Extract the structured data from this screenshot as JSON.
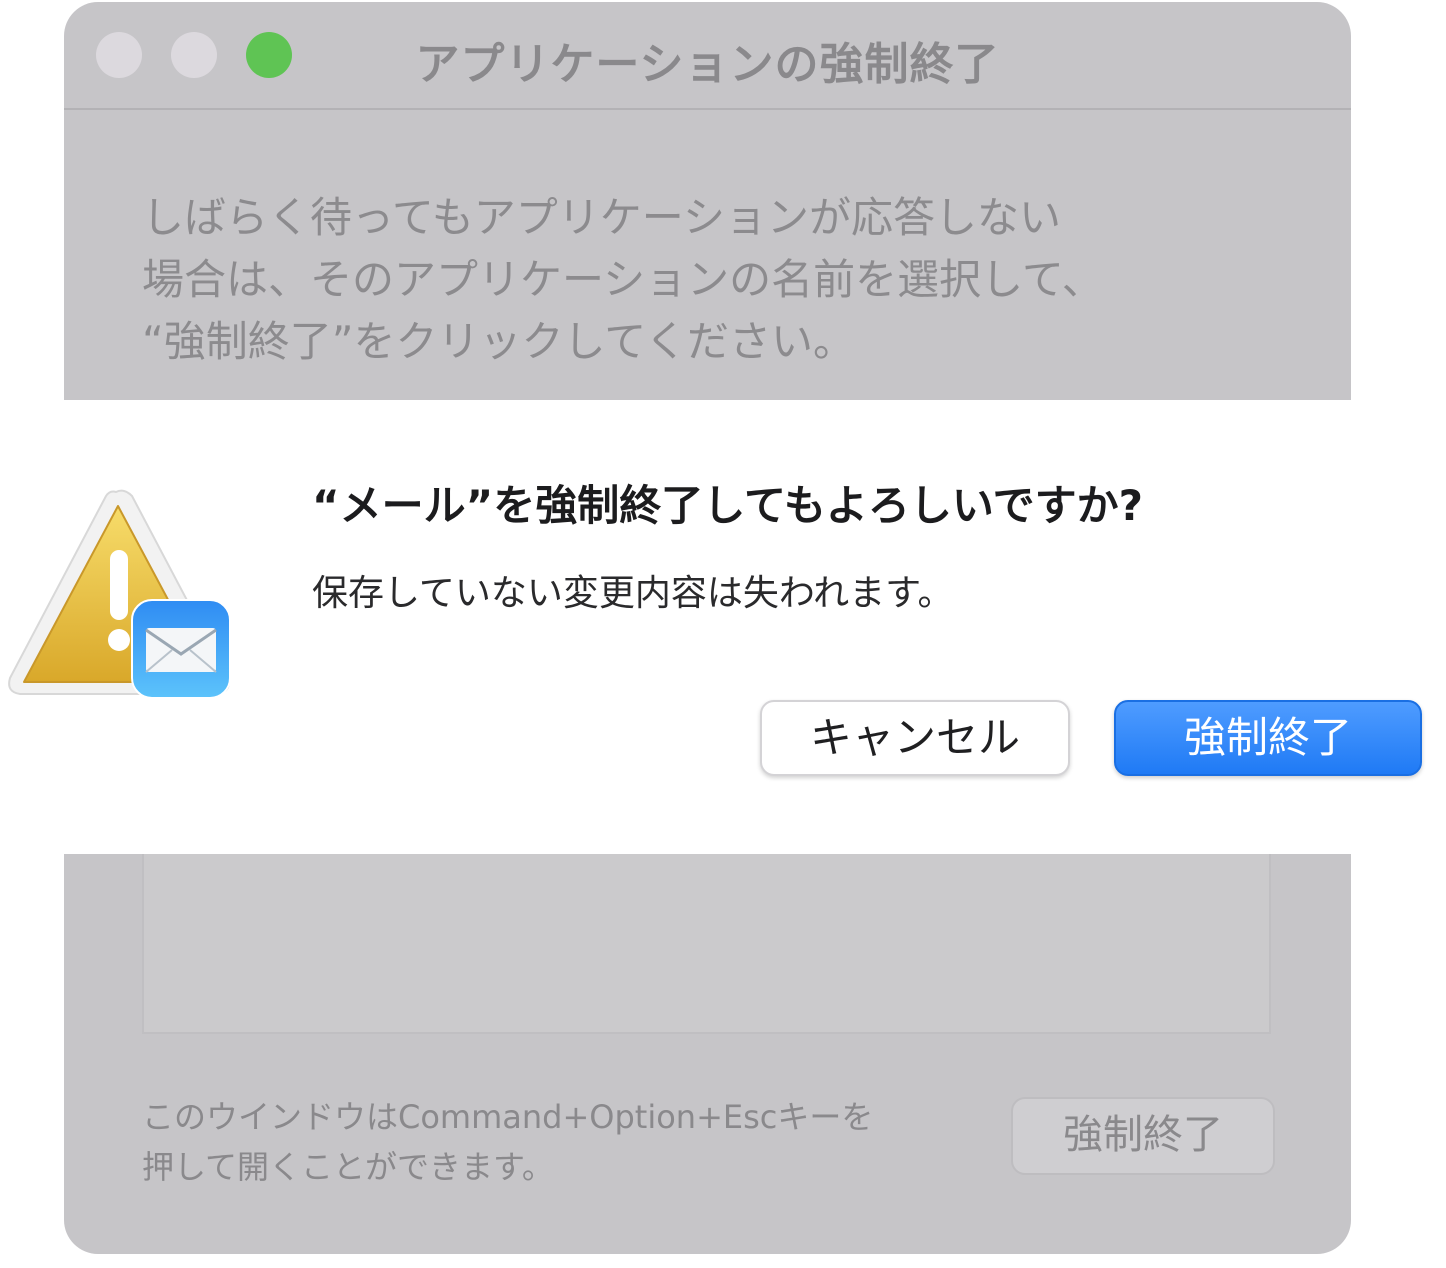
{
  "window": {
    "title": "アプリケーションの強制終了",
    "description_lines": [
      "しばらく待ってもアプリケーションが応答しない",
      "場合は、そのアプリケーションの名前を選択して、",
      "“強制終了”をクリックしてください。"
    ],
    "footer_lines": [
      "このウインドウはCommand+Option+Escキーを",
      "押して開くことができます。"
    ],
    "force_quit_label": "強制終了"
  },
  "alert": {
    "title": "“メール”を強制終了してもよろしいですか?",
    "message": "保存していない変更内容は失われます。",
    "cancel_label": "キャンセル",
    "confirm_label": "強制終了",
    "icon": "warning-triangle-with-mail-icon"
  },
  "colors": {
    "accent": "#1f7af5",
    "traffic_zoom": "#5fc454",
    "warning_yellow": "#e8b83a"
  }
}
